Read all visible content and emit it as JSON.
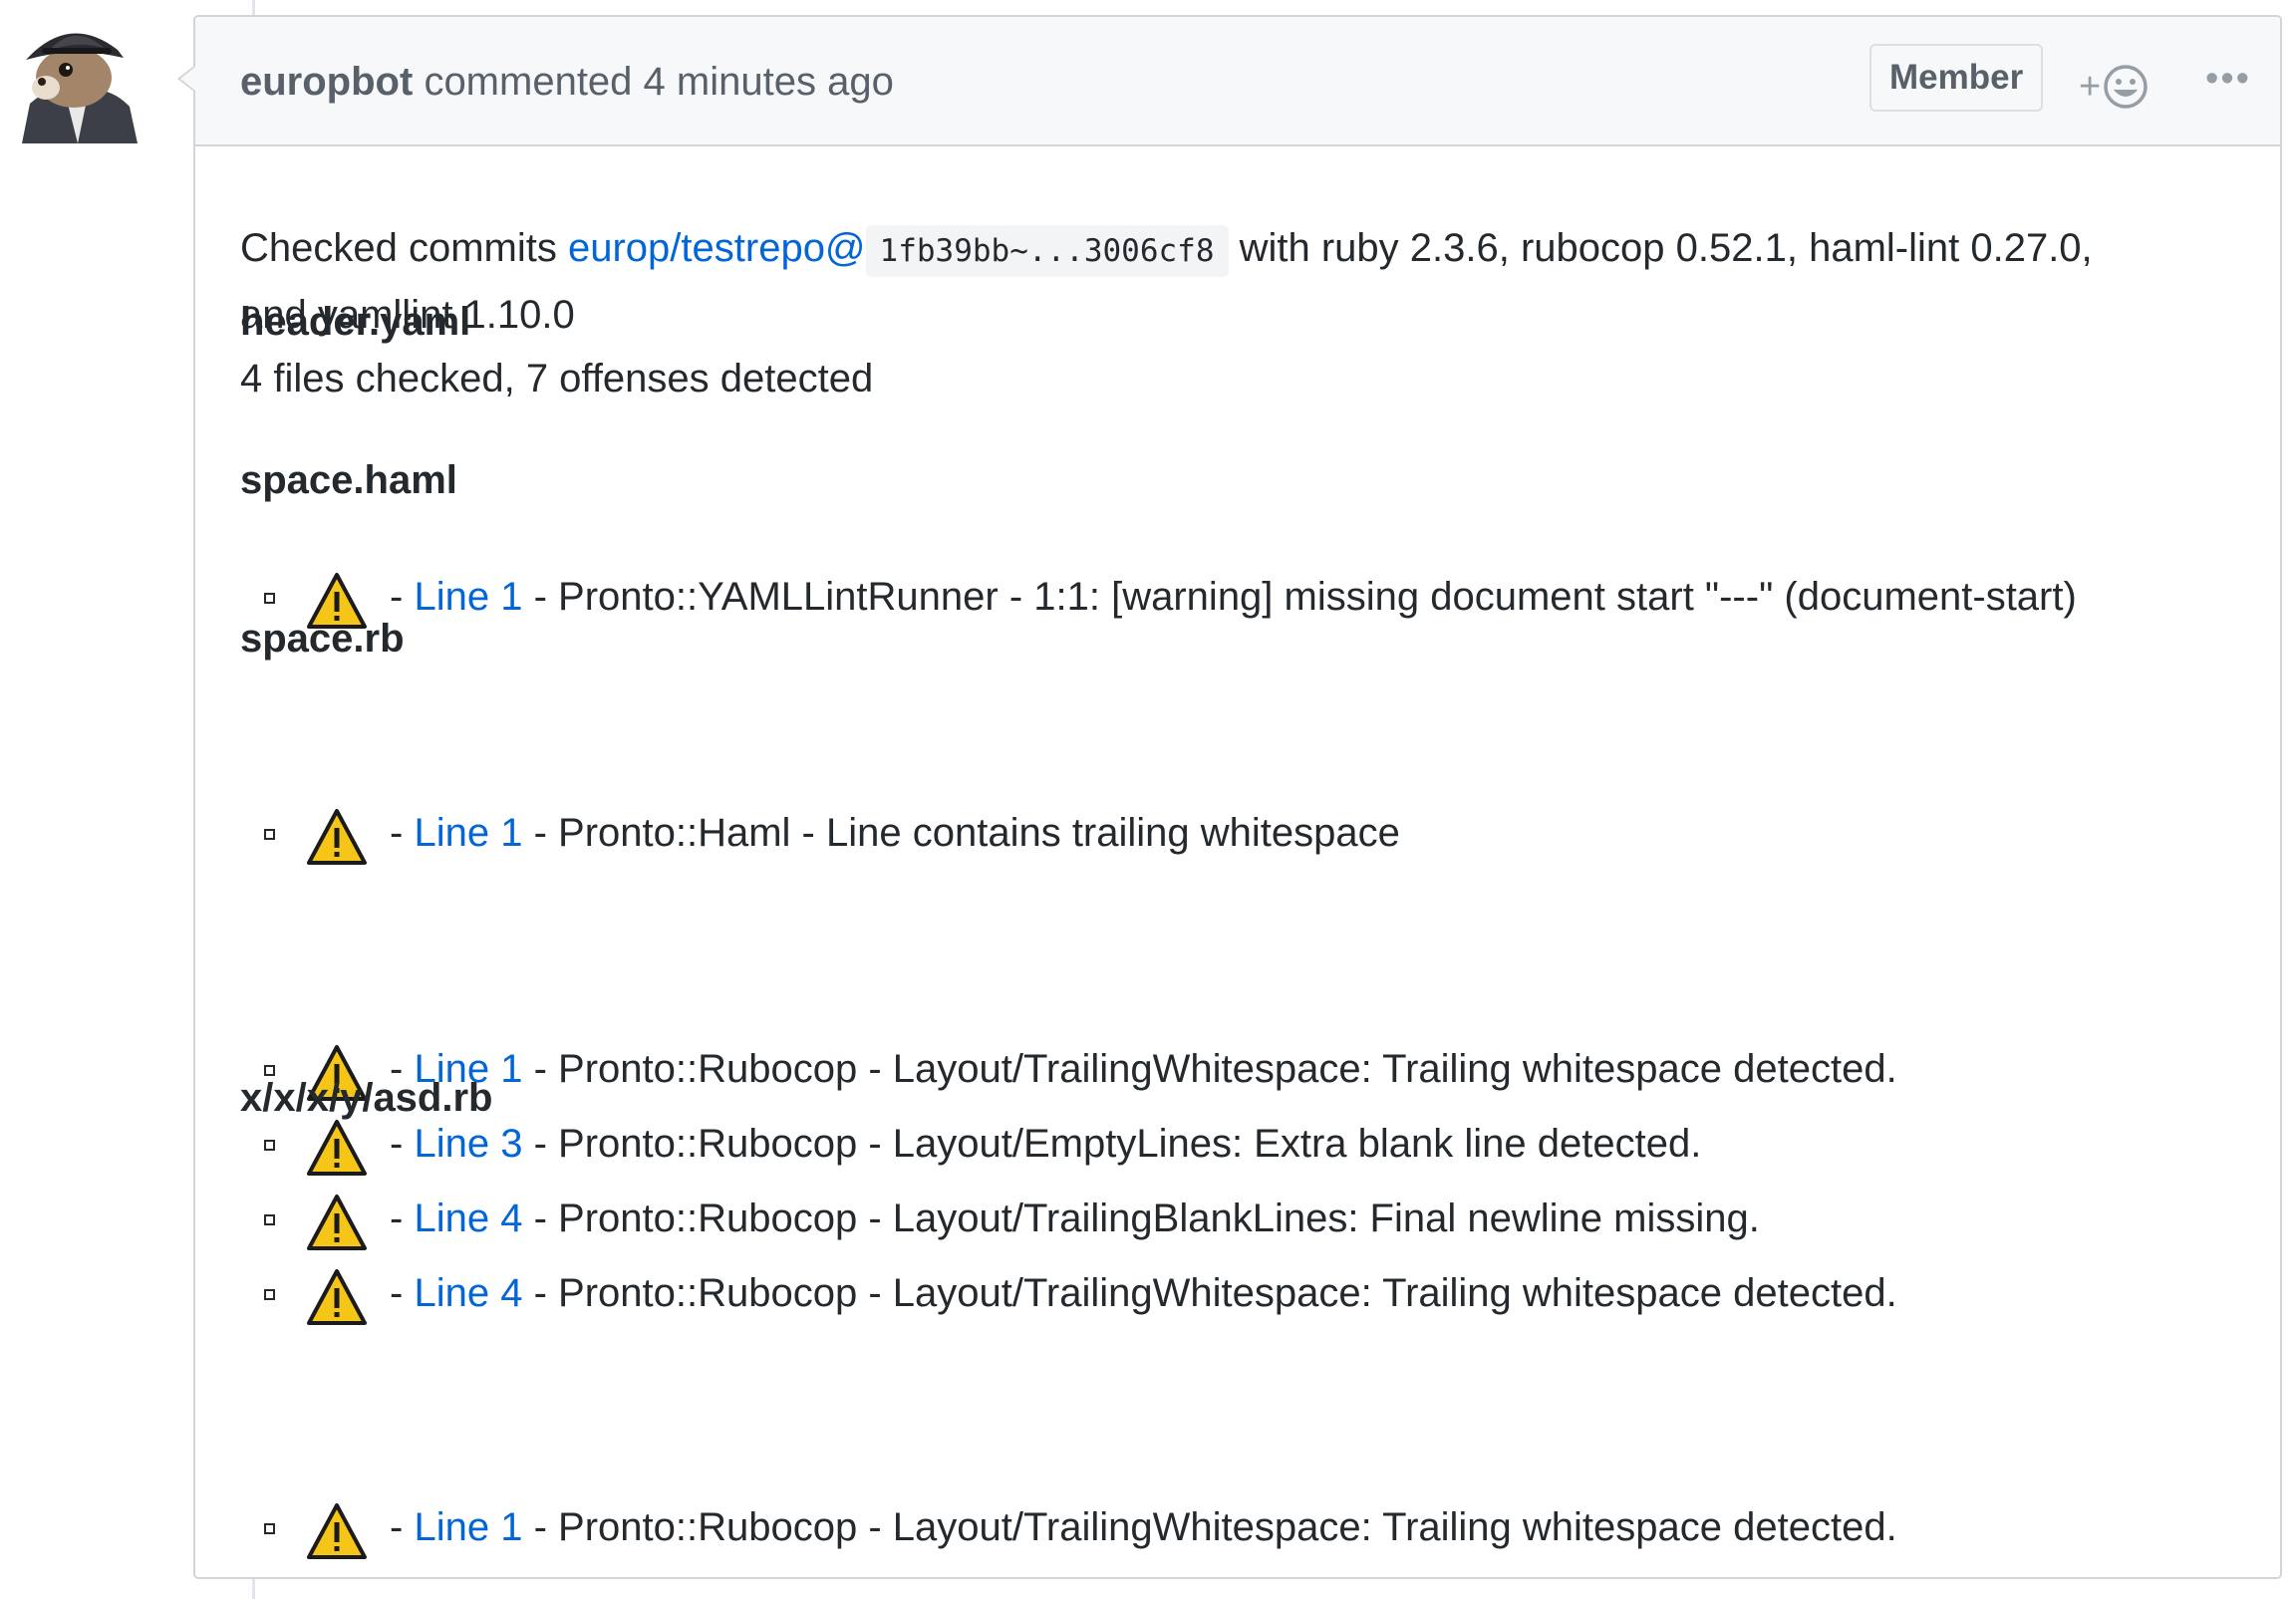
{
  "comment": {
    "author": "europbot",
    "action_text": "commented",
    "timestamp": "4 minutes ago",
    "role_badge": "Member",
    "reaction_plus": "+",
    "more_label": "•••"
  },
  "intro": {
    "prefix": "Checked commits ",
    "repo_link": "europ/testrepo@",
    "commit_range": "1fb39bb~...3006cf8",
    "suffix_line1": " with ruby 2.3.6, rubocop 0.52.1, haml-lint 0.27.0,",
    "line2": "and yamllint 1.10.0",
    "line3": "4 files checked, 7 offenses detected"
  },
  "dash": "-",
  "files": [
    {
      "name": "header.yaml",
      "offenses": [
        {
          "line": "Line 1",
          "message": "Pronto::YAMLLintRunner - 1:1: [warning] missing document start \"---\" (document-start)"
        }
      ]
    },
    {
      "name": "space.haml",
      "offenses": [
        {
          "line": "Line 1",
          "message": "Pronto::Haml - Line contains trailing whitespace"
        }
      ]
    },
    {
      "name": "space.rb",
      "offenses": [
        {
          "line": "Line 1",
          "message": "Pronto::Rubocop - Layout/TrailingWhitespace: Trailing whitespace detected."
        },
        {
          "line": "Line 3",
          "message": "Pronto::Rubocop - Layout/EmptyLines: Extra blank line detected."
        },
        {
          "line": "Line 4",
          "message": "Pronto::Rubocop - Layout/TrailingBlankLines: Final newline missing."
        },
        {
          "line": "Line 4",
          "message": "Pronto::Rubocop - Layout/TrailingWhitespace: Trailing whitespace detected."
        }
      ]
    },
    {
      "name": "x/x/x/y/asd.rb",
      "offenses": [
        {
          "line": "Line 1",
          "message": "Pronto::Rubocop - Layout/TrailingWhitespace: Trailing whitespace detected."
        }
      ]
    }
  ],
  "icons": {
    "warning": "warning-icon",
    "reaction": "smiley-icon",
    "avatar": "squirrel-avatar"
  },
  "colors": {
    "link": "#0366d6",
    "warning_fill": "#f5c518",
    "header_bg": "#f6f8fa",
    "border": "#d1d5da"
  }
}
